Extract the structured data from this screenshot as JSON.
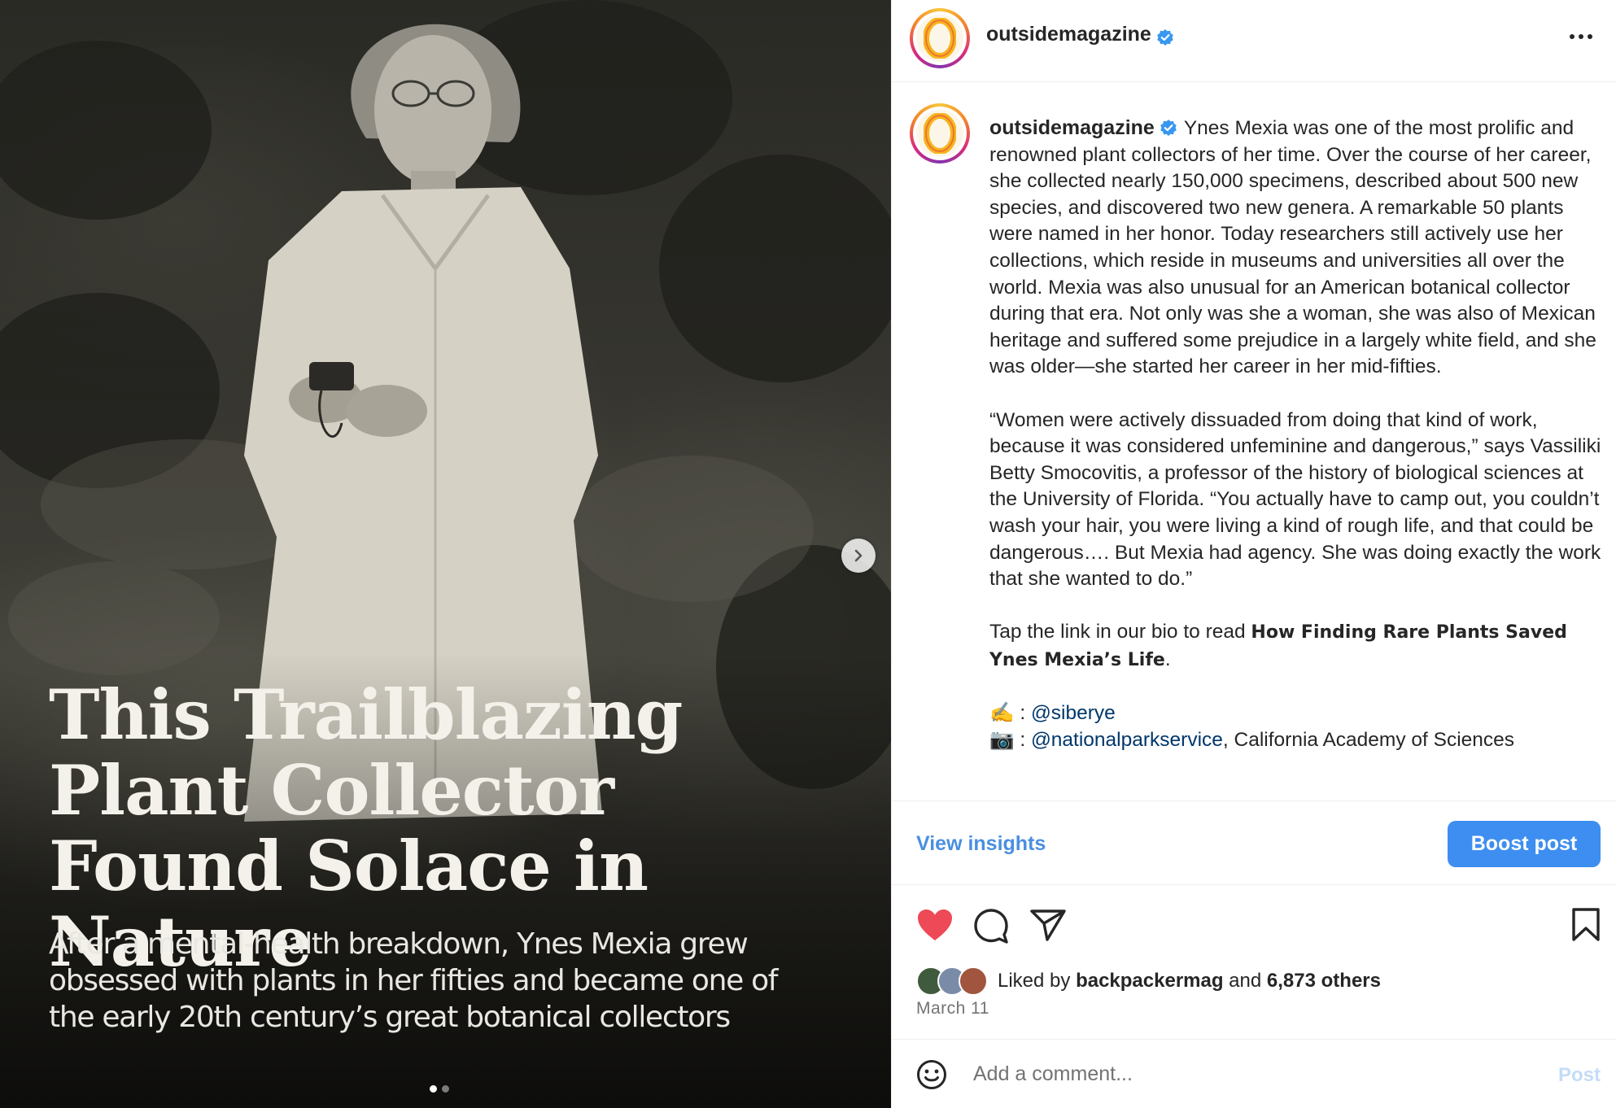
{
  "media": {
    "headline": "This Trailblazing Plant Collector Found Solace in Nature",
    "subhead": "After a mental-health breakdown, Ynes Mexia grew obsessed with plants in her fifties and became one of the early 20th century’s great botanical collectors",
    "slide_dots": 2,
    "active_slide": 1
  },
  "header": {
    "username": "outsidemagazine",
    "avatar_letter": "O"
  },
  "caption": {
    "username": "outsidemagazine",
    "paragraph1": "Ynes Mexia was one of the most prolific and renowned plant collectors of her time. Over the course of her career, she collected nearly 150,000 specimens, described about 500 new species, and discovered two new genera. A remarkable 50 plants were named in her honor. Today researchers still actively use her collections, which reside in museums and universities all over the world. Mexia was also unusual for an American botanical collector during that era. Not only was she a woman, she was also of Mexican heritage and suffered some prejudice in a largely white field, and she was older—she started her career in her mid-fifties.",
    "paragraph2": "“Women were actively dissuaded from doing that kind of work, because it was considered unfeminine and dangerous,” says Vassiliki Betty Smocovitis, a professor of the history of biological sciences at the University of Florida. “You actually have to camp out, you couldn’t wash your hair, you were living a kind of rough life, and that could be dangerous…. But Mexia had agency. She was doing exactly the work that she wanted to do.”",
    "cta_prefix": "Tap the link in our bio to read ",
    "cta_title": "How Finding Rare Plants Saved Ynes Mexia’s Life",
    "cta_suffix": ".",
    "credit1_emoji": "✍️",
    "credit1_sep": " : ",
    "credit1_handle": "@siberye",
    "credit2_emoji": "📷",
    "credit2_sep": " : ",
    "credit2_handle": "@nationalparkservice",
    "credit2_rest": ", California Academy of Sciences"
  },
  "insights": {
    "view_label": "View insights",
    "boost_label": "Boost post"
  },
  "engagement": {
    "liked_prefix": "Liked by ",
    "liked_user": "backpackermag",
    "liked_mid": " and ",
    "liked_count": "6,873 others",
    "date": "March 11",
    "liked": true,
    "heart_color": "#ed4956"
  },
  "comment": {
    "placeholder": "Add a comment...",
    "post_label": "Post"
  },
  "colors": {
    "accent": "#3d8ef0",
    "link": "#00376b",
    "verified": "#3897f0"
  }
}
